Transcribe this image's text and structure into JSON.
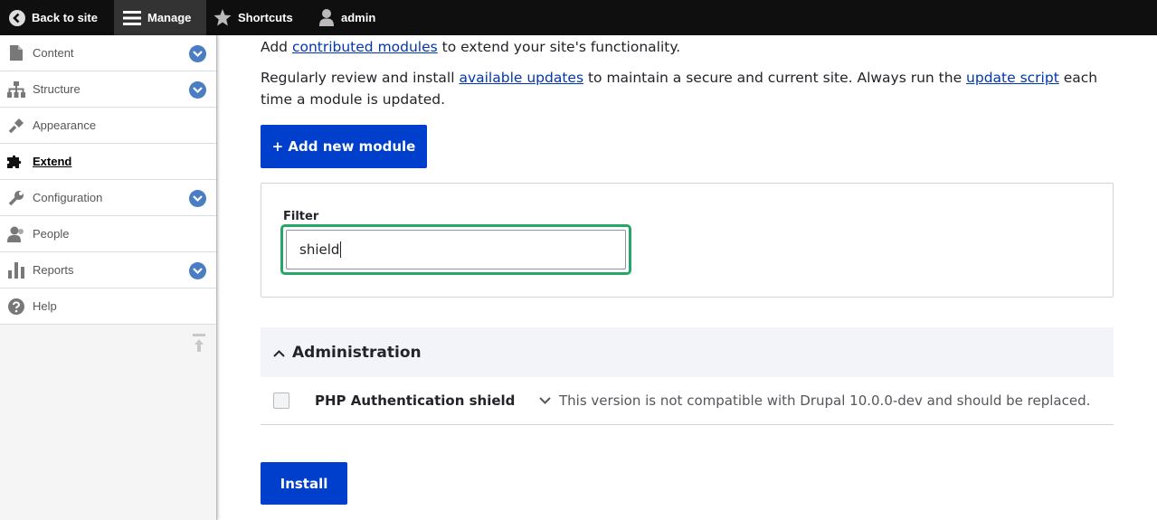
{
  "toolbar": {
    "back": "Back to site",
    "manage": "Manage",
    "shortcuts": "Shortcuts",
    "user": "admin"
  },
  "sidebar": {
    "items": [
      {
        "label": "Content",
        "icon": "file-icon",
        "expandable": true
      },
      {
        "label": "Structure",
        "icon": "sitemap-icon",
        "expandable": true
      },
      {
        "label": "Appearance",
        "icon": "paintbrush-icon",
        "expandable": false
      },
      {
        "label": "Extend",
        "icon": "puzzle-icon",
        "expandable": false,
        "active": true
      },
      {
        "label": "Configuration",
        "icon": "wrench-icon",
        "expandable": true
      },
      {
        "label": "People",
        "icon": "people-icon",
        "expandable": false
      },
      {
        "label": "Reports",
        "icon": "bar-chart-icon",
        "expandable": true
      },
      {
        "label": "Help",
        "icon": "help-icon",
        "expandable": false
      }
    ]
  },
  "intro": {
    "p1_before": "Add ",
    "p1_link": "contributed modules",
    "p1_after": " to extend your site's functionality.",
    "p2_before": "Regularly review and install ",
    "p2_link1": "available updates",
    "p2_mid": " to maintain a secure and current site. Always run the ",
    "p2_link2": "update script",
    "p2_after": " each time a module is updated."
  },
  "add_button": "+ Add new module",
  "filter": {
    "label": "Filter",
    "value": "shield"
  },
  "group": {
    "title": "Administration"
  },
  "modules": [
    {
      "name": "PHP Authentication shield",
      "description": "This version is not compatible with Drupal 10.0.0-dev and should be replaced."
    }
  ],
  "install_button": "Install",
  "colors": {
    "primary": "#003ecc",
    "focus": "#26a769",
    "link": "#0036b1"
  }
}
